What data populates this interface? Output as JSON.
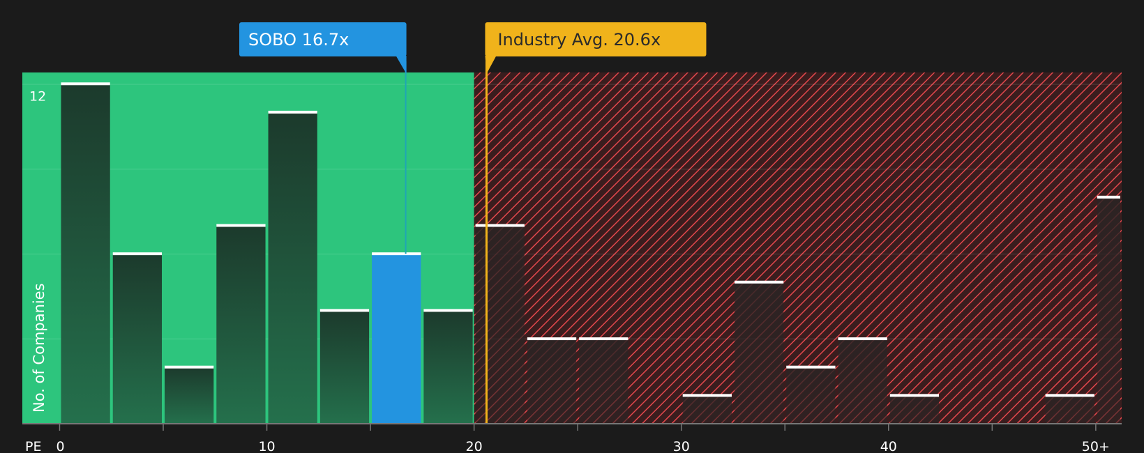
{
  "chart_data": {
    "type": "bar",
    "ylabel": "No. of Companies",
    "xlabel": "PE",
    "ylim": [
      0,
      12.4
    ],
    "y_ticks_labeled": [
      12
    ],
    "x_tick_labels": [
      {
        "value": 0,
        "label": "0"
      },
      {
        "value": 10,
        "label": "10"
      },
      {
        "value": 20,
        "label": "20"
      },
      {
        "value": 30,
        "label": "30"
      },
      {
        "value": 40,
        "label": "40"
      },
      {
        "value": 50,
        "label": "50+"
      }
    ],
    "bins": [
      {
        "start": 0,
        "end": 2.5,
        "count": 12
      },
      {
        "start": 2.5,
        "end": 5,
        "count": 6
      },
      {
        "start": 5,
        "end": 7.5,
        "count": 2
      },
      {
        "start": 7.5,
        "end": 10,
        "count": 7
      },
      {
        "start": 10,
        "end": 12.5,
        "count": 11
      },
      {
        "start": 12.5,
        "end": 15,
        "count": 4
      },
      {
        "start": 15,
        "end": 17.5,
        "count": 6,
        "highlight": true
      },
      {
        "start": 17.5,
        "end": 20,
        "count": 4
      },
      {
        "start": 20,
        "end": 22.5,
        "count": 7
      },
      {
        "start": 22.5,
        "end": 25,
        "count": 3
      },
      {
        "start": 25,
        "end": 27.5,
        "count": 3
      },
      {
        "start": 27.5,
        "end": 30,
        "count": 0
      },
      {
        "start": 30,
        "end": 32.5,
        "count": 1
      },
      {
        "start": 32.5,
        "end": 35,
        "count": 5
      },
      {
        "start": 35,
        "end": 37.5,
        "count": 2
      },
      {
        "start": 37.5,
        "end": 40,
        "count": 3
      },
      {
        "start": 40,
        "end": 42.5,
        "count": 1
      },
      {
        "start": 42.5,
        "end": 45,
        "count": 0
      },
      {
        "start": 45,
        "end": 47.5,
        "count": 0
      },
      {
        "start": 47.5,
        "end": 50,
        "count": 1
      },
      {
        "start": 50,
        "end": 51.25,
        "count": 8
      }
    ],
    "x_range": [
      -1.8,
      51.25
    ],
    "fair_threshold": 20,
    "company": {
      "name": "SOBO",
      "value": 16.7,
      "label": "SOBO 16.7x"
    },
    "industry": {
      "value": 20.6,
      "label": "Industry Avg. 20.6x"
    },
    "colors": {
      "background": "#1b1b1b",
      "good_zone": "#2dc57d",
      "bad_zone": "#8b2b2e",
      "hatch": "#e2474c",
      "bar_dark": "#1e3a2c",
      "highlight_bar": "#2394e0",
      "company_marker": "#2394e0",
      "industry_marker": "#f0b31b",
      "bar_cap": "#ffffff"
    }
  }
}
